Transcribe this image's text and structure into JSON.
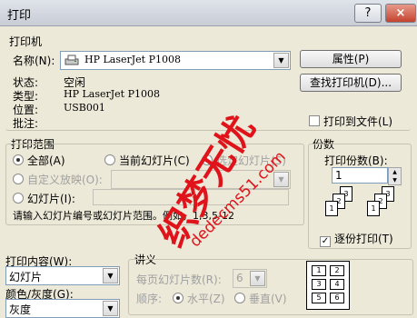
{
  "window": {
    "title": "打印",
    "help_label": "?",
    "close_label": "×"
  },
  "printer": {
    "section_label": "打印机",
    "name_label": "名称(N):",
    "name_value": "HP LaserJet P1008",
    "status_label": "状态:",
    "status_value": "空闲",
    "type_label": "类型:",
    "type_value": "HP LaserJet P1008",
    "location_label": "位置:",
    "location_value": "USB001",
    "comment_label": "批注:",
    "properties_button": "属性(P)",
    "find_printer_button": "查找打印机(D)...",
    "print_to_file_label": "打印到文件(L)"
  },
  "print_range": {
    "section_label": "打印范围",
    "all_label": "全部(A)",
    "current_slide_label": "当前幻灯片(C)",
    "selection_label": "选定幻灯片(S)",
    "custom_show_label": "自定义放映(O):",
    "slides_label": "幻灯片(I):",
    "hint": "请输入幻灯片编号或幻灯片范围。例如，1,3,5-12"
  },
  "copies": {
    "section_label": "份数",
    "count_label": "打印份数(B):",
    "count_value": "1",
    "collate_label": "逐份打印(T)",
    "sheet_labels": [
      "1",
      "2",
      "3",
      "1",
      "2",
      "3"
    ]
  },
  "print_what": {
    "label": "打印内容(W):",
    "value": "幻灯片"
  },
  "color": {
    "label": "颜色/灰度(G):",
    "value": "灰度"
  },
  "handouts": {
    "section_label": "讲义",
    "per_page_label": "每页幻灯片数(R):",
    "per_page_value": "6",
    "order_label": "顺序:",
    "horizontal_label": "水平(Z)",
    "vertical_label": "垂直(V)",
    "preview_numbers": [
      "1",
      "2",
      "3",
      "4",
      "5",
      "6"
    ]
  },
  "watermark": {
    "text": "织梦无忧",
    "url": "dedecms51.com"
  }
}
